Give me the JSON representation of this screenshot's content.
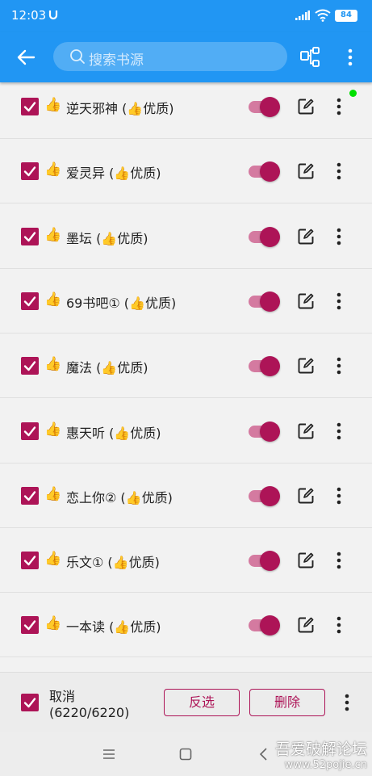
{
  "status_bar": {
    "time": "12:03",
    "battery": "84"
  },
  "toolbar": {
    "search_placeholder": "搜索书源"
  },
  "sources": [
    {
      "name": "逆天邪神 (👍优质)",
      "checked": true,
      "enabled": true
    },
    {
      "name": "爱灵异 (👍优质)",
      "checked": true,
      "enabled": true
    },
    {
      "name": "墨坛 (👍优质)",
      "checked": true,
      "enabled": true
    },
    {
      "name": "69书吧① (👍优质)",
      "checked": true,
      "enabled": true
    },
    {
      "name": "魔法 (👍优质)",
      "checked": true,
      "enabled": true
    },
    {
      "name": "惠天听 (👍优质)",
      "checked": true,
      "enabled": true
    },
    {
      "name": "恋上你② (👍优质)",
      "checked": true,
      "enabled": true
    },
    {
      "name": "乐文① (👍优质)",
      "checked": true,
      "enabled": true
    },
    {
      "name": "一本读 (👍优质)",
      "checked": true,
      "enabled": true
    }
  ],
  "thumb_emoji": "👍",
  "bottom_bar": {
    "cancel_label": "取消",
    "count": "(6220/6220)",
    "invert_label": "反选",
    "delete_label": "删除"
  },
  "watermark": {
    "line1": "吾爱破解论坛",
    "line2": "www.52pojie.cn"
  },
  "colors": {
    "primary": "#2196f3",
    "accent": "#ad1457",
    "switch_track": "#d47aa0",
    "status_dot": "#00e000"
  }
}
